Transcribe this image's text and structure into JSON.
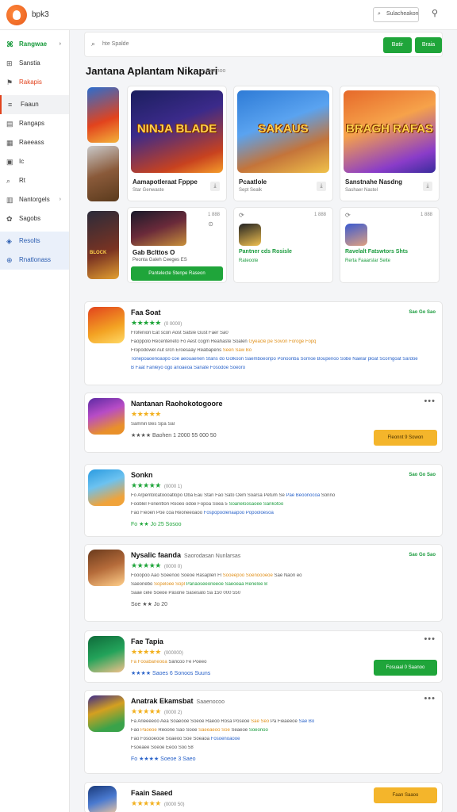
{
  "app": {
    "brand": "bpk3",
    "top_search_label": "Sulacheakon"
  },
  "sidebar": {
    "items": [
      {
        "label": "Rangwae",
        "icon": "gamepad",
        "chev": "›",
        "style": "active-green"
      },
      {
        "label": "Sanstia",
        "icon": "tag",
        "chev": "",
        "style": ""
      },
      {
        "label": "Rakapis",
        "icon": "trophy",
        "chev": "",
        "style": "red"
      },
      {
        "label": "Faaun",
        "icon": "list",
        "chev": "",
        "style": "selected"
      },
      {
        "label": "Rangaps",
        "icon": "doc",
        "chev": "",
        "style": ""
      },
      {
        "label": "Raeeass",
        "icon": "grid",
        "chev": "",
        "style": ""
      },
      {
        "label": "Ic",
        "icon": "box",
        "chev": "",
        "style": ""
      },
      {
        "label": "Rt",
        "icon": "search",
        "chev": "",
        "style": ""
      },
      {
        "label": "Nantorgels",
        "icon": "doc2",
        "chev": "›",
        "style": ""
      },
      {
        "label": "Sagobs",
        "icon": "gift",
        "chev": "",
        "style": ""
      },
      {
        "label": "Resolts",
        "icon": "shield",
        "chev": "",
        "style": "blue-bg"
      },
      {
        "label": "Rnatlonass",
        "icon": "globe",
        "chev": "",
        "style": "blue-bg"
      }
    ]
  },
  "search": {
    "placeholder": "hte Spalde",
    "btn1": "Batir",
    "btn2": "Braia"
  },
  "section": {
    "title": "Jantana Aplantam Nikapari",
    "sub": "Geenoo"
  },
  "featured": [
    {
      "name": "Aamapotleraat Fpppe",
      "meta": "Star Genwaste",
      "overlay": "NINJA BLADE",
      "bg": "linear-gradient(160deg,#1b1f5e,#3b2a8a 40%,#c8421f 80%,#f59d2a)"
    },
    {
      "name": "Pcaatlole",
      "meta": "Sept Sealk",
      "overlay": "SAKAUS",
      "bg": "linear-gradient(160deg,#2e7bd6,#5aa3f0 40%,#c4743a 70%,#f0c24a)"
    },
    {
      "name": "Sanstnahe Nasdng",
      "meta": "Sashaer Nastel",
      "overlay": "BRAGH RAFAS",
      "bg": "linear-gradient(160deg,#e6692a,#f6a24a 40%,#8a3cc9 80%,#3a2c9c)"
    }
  ],
  "small_cards": [
    {
      "name": "Gab Bclttos O",
      "meta": "Peonta Galeh Ceeges ES",
      "count": "1 888",
      "btn": "Pantelecte Stenpe Raseon",
      "dark": true
    },
    {
      "name": "Pantner cds Rosisle",
      "meta": "Rateoote",
      "count": "1 888",
      "btn": "",
      "dark": false
    },
    {
      "name": "Ravelalt Fatswtors Shts",
      "meta": "Rerta Faaarslar Seite",
      "count": "1 888",
      "btn": "",
      "dark": false
    }
  ],
  "apps": [
    {
      "name": "Faa Soat",
      "sub": "",
      "stars": "★★★★★",
      "star_style": "green",
      "rating_count": "(0 0000)",
      "lines": [
        [
          {
            "t": "Frofenion Eat scon Aost Satsle Gust Faer Sa0",
            "c": ""
          }
        ],
        [
          {
            "t": "Faoppolo Recenteneto Fo Aest cogm Reahaste Soalen ",
            "c": ""
          },
          {
            "t": "Gyeacle pe Sovon Foroge Fopq",
            "c": "o"
          }
        ],
        [
          {
            "t": "Fropodowel Aut srcn Eroesaay Reabapens ",
            "c": ""
          },
          {
            "t": "Seen Saw Bo ",
            "c": "o"
          }
        ],
        [
          {
            "t": "Tonepoaoenoaopo coe aeouaenen Stans do ",
            "c": "b"
          },
          {
            "t": "Golkoon Saemboeonpo Ponoonba Sornoe Boupenoo ",
            "c": "b"
          },
          {
            "t": "Sobe Naelar ploat Scorngoat Sardoe",
            "c": "b"
          }
        ],
        [
          {
            "t": "B Faat Fanleyo ogo anoaeoa Sanate Fosodoe Soeoro",
            "c": "b"
          }
        ]
      ],
      "rating_row": "",
      "action": "",
      "free": "Sao Go Sao",
      "more": false,
      "icon": "linear-gradient(160deg,#e2431d,#f3a323 60%,#ffd966)"
    },
    {
      "name": "Nantanan Raohokotogoore",
      "sub": "",
      "stars": "★★★★★",
      "star_style": "",
      "rating_count": "",
      "lines": [
        [
          {
            "t": "Samnin Bes Spa Sal",
            "c": ""
          }
        ]
      ],
      "rating_row": "★★★★ Baohen 1 2000 55 000 50",
      "rating_style": "",
      "action": "Fleonnt 9 Sowon",
      "action_style": "yellow",
      "free": "",
      "more": true,
      "icon": "linear-gradient(160deg,#5d2aa3,#b74cc6 40%,#e9902a 80%)"
    },
    {
      "name": "Sonkn",
      "sub": "",
      "stars": "★★★★★",
      "star_style": "green",
      "rating_count": "(0000 1)",
      "lines": [
        [
          {
            "t": "Fo Arpentolcatoooatlopo Oba Eau Stan Fao Sato Oem Soarsa Petum Se ",
            "c": ""
          },
          {
            "t": "Pae Beoonocoa",
            "c": "b"
          },
          {
            "t": " Sonno",
            "c": ""
          }
        ],
        [
          {
            "t": "Fooblel Fonentlon Rooeo odoe Fopoa Soea 5 ",
            "c": ""
          },
          {
            "t": "Soaneloosaoee Sankotoo",
            "c": "g"
          }
        ],
        [
          {
            "t": "Fao Fieoen Poe coa Reoneeoaoo ",
            "c": ""
          },
          {
            "t": "Fospopoolenaapoo Popooloesoa",
            "c": "b"
          }
        ]
      ],
      "rating_row": "Fo ★★ Jo 25 Sosoo",
      "rating_style": "g",
      "action": "",
      "free": "Sao Go Sao",
      "more": false,
      "icon": "linear-gradient(160deg,#2b9be0,#6cc2f0 40%,#f0a33a 80%)"
    },
    {
      "name": "Nysalic faanda",
      "sub": "Saorodasan Nunlarsas",
      "stars": "★★★★★",
      "star_style": "green",
      "rating_count": "(0000 0)",
      "lines": [
        [
          {
            "t": "Fooopoo Aao Soeenoo Soeoe Rasaplen Fl ",
            "c": ""
          },
          {
            "t": "Sooeepoo Soenoooeoe",
            "c": "o"
          },
          {
            "t": " Sae Naon eo",
            "c": ""
          }
        ],
        [
          {
            "t": "Saeonebo ",
            "c": ""
          },
          {
            "t": "Sopeloee Sopl",
            "c": "o"
          },
          {
            "t": " Panaoseeoneeoe Saeoeaa Reneloe B",
            "c": "g"
          }
        ],
        [
          {
            "t": "Saae cele Soeoe Pasone Sasesalo Sa 150 000 550",
            "c": ""
          }
        ]
      ],
      "rating_row": "Soe ★★ Jo 20",
      "rating_style": "",
      "action": "",
      "free": "Sao Go Sao",
      "more": false,
      "icon": "linear-gradient(160deg,#6a3a1c,#b56b3a 50%,#ffcf8a)"
    },
    {
      "name": "Fae Tapia",
      "sub": "",
      "stars": "★★★★★",
      "star_style": "",
      "rating_count": "(000000)",
      "lines": [
        [
          {
            "t": "Fa Fooabaneooa ",
            "c": "o"
          },
          {
            "t": "Sancoo Fe Poeeo",
            "c": ""
          }
        ]
      ],
      "rating_row": "★★★★ Saoes 6 Sonoos Suuns",
      "rating_style": "b",
      "action": "Fosuaal 0 Saanoo",
      "action_style": "green",
      "free": "",
      "more": true,
      "icon": "linear-gradient(160deg,#0f6b3a,#23a35a 50%,#f2c08a)"
    },
    {
      "name": "Anatrak Ekamsbat",
      "sub": "Saaenocoo",
      "stars": "★★★★★",
      "star_style": "",
      "rating_count": "(0000 2)",
      "lines": [
        [
          {
            "t": "Fa Arieeeeoo Aea Soaeooe Soeoe Raeoo Rosa Poseoe ",
            "c": ""
          },
          {
            "t": "Sae Seo",
            "c": "o"
          },
          {
            "t": " Pa Fieaeeoe ",
            "c": ""
          },
          {
            "t": "Sae Bo",
            "c": "b"
          }
        ],
        [
          {
            "t": "Fao ",
            "c": ""
          },
          {
            "t": "Paoeoe",
            "c": "o"
          },
          {
            "t": " Reoone Sao Sooe ",
            "c": ""
          },
          {
            "t": "Saeeaeoo Soe",
            "c": "o"
          },
          {
            "t": " Seaeoe ",
            "c": ""
          },
          {
            "t": "Soeonoo",
            "c": "g"
          }
        ],
        [
          {
            "t": "Fao Fosooeooe Soaeoo Soe Soeaoa ",
            "c": ""
          },
          {
            "t": "Fosoenoaooe",
            "c": "b"
          }
        ],
        [
          {
            "t": "Fsoeaee Soeoe Eeoo Soo 58",
            "c": ""
          }
        ]
      ],
      "rating_row": "Fo ★★★★ Soeoe 3 Saeo",
      "rating_style": "b",
      "action": "",
      "free": "",
      "more": true,
      "icon": "linear-gradient(160deg,#3c2a8a,#d4a020 40%,#3aa34a 80%)"
    },
    {
      "name": "Faain Saaed",
      "sub": "",
      "stars": "★★★★★",
      "star_style": "",
      "rating_count": "(0000 50)",
      "lines": [],
      "rating_row": "",
      "action": "Faan Saaoo",
      "action_style": "yellow",
      "free": "",
      "more": false,
      "icon": "linear-gradient(160deg,#1a3a7a,#4a7ad0 50%,#f0c8a0)"
    }
  ]
}
